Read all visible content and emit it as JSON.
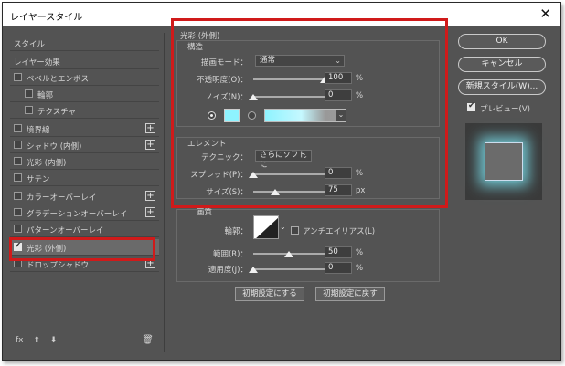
{
  "window": {
    "title": "レイヤースタイル",
    "close_glyph": "✕"
  },
  "sidebar": {
    "items": [
      {
        "label": "スタイル",
        "checkbox": false,
        "plus": false,
        "selected": false
      },
      {
        "label": "レイヤー効果",
        "checkbox": false,
        "plus": false,
        "selected": false
      },
      {
        "label": "ベベルとエンボス",
        "checkbox": true,
        "plus": false,
        "selected": false
      },
      {
        "label": "輪郭",
        "checkbox": true,
        "plus": false,
        "selected": false
      },
      {
        "label": "テクスチャ",
        "checkbox": true,
        "plus": false,
        "selected": false
      },
      {
        "label": "境界線",
        "checkbox": true,
        "plus": true,
        "selected": false
      },
      {
        "label": "シャドウ (内側)",
        "checkbox": true,
        "plus": true,
        "selected": false
      },
      {
        "label": "光彩 (内側)",
        "checkbox": true,
        "plus": false,
        "selected": false
      },
      {
        "label": "サテン",
        "checkbox": true,
        "plus": false,
        "selected": false
      },
      {
        "label": "カラーオーバーレイ",
        "checkbox": true,
        "plus": true,
        "selected": false
      },
      {
        "label": "グラデーションオーバーレイ",
        "checkbox": true,
        "plus": true,
        "selected": false
      },
      {
        "label": "パターンオーバーレイ",
        "checkbox": true,
        "plus": false,
        "selected": false
      },
      {
        "label": "光彩 (外側)",
        "checkbox": true,
        "plus": false,
        "selected": true
      },
      {
        "label": "ドロップシャドウ",
        "checkbox": true,
        "plus": true,
        "selected": false
      }
    ],
    "footer": {
      "fx": "fx",
      "up": "⬆",
      "down": "⬇",
      "trash": "🗑"
    }
  },
  "outer_glow": {
    "title": "光彩 (外側)",
    "structure": {
      "title": "構造",
      "blend_mode_label": "描画モード：",
      "blend_mode_value": "通常",
      "opacity_label": "不透明度(O)：",
      "opacity_value": "100",
      "opacity_pct": 1.0,
      "noise_label": "ノイズ(N)：",
      "noise_value": "0",
      "noise_pct": 0.0,
      "percent": "%",
      "glow_color": "#8ef3ff"
    },
    "elements": {
      "title": "エレメント",
      "technique_label": "テクニック：",
      "technique_value": "さらにソフトに",
      "spread_label": "スプレッド(P)：",
      "spread_value": "0",
      "spread_pct": 0.0,
      "size_label": "サイズ(S)：",
      "size_value": "75",
      "size_pct": 0.31,
      "percent": "%",
      "px": "px"
    },
    "quality": {
      "title": "画質",
      "contour_label": "輪郭：",
      "antialias_label": "アンチエイリアス(L)",
      "range_label": "範囲(R)：",
      "range_value": "50",
      "range_pct": 0.5,
      "jitter_label": "適用度(J)：",
      "jitter_value": "0",
      "jitter_pct": 0.0,
      "percent": "%"
    },
    "buttons": {
      "make_default": "初期設定にする",
      "reset_default": "初期設定に戻す"
    }
  },
  "right": {
    "ok": "OK",
    "cancel": "キャンセル",
    "new_style": "新規スタイル(W)...",
    "preview_label": "プレビュー(V)",
    "preview_checked": true
  },
  "colors": {
    "highlight": "#d01a1a",
    "glow": "#8ef3ff",
    "panel_bg": "#535353"
  }
}
